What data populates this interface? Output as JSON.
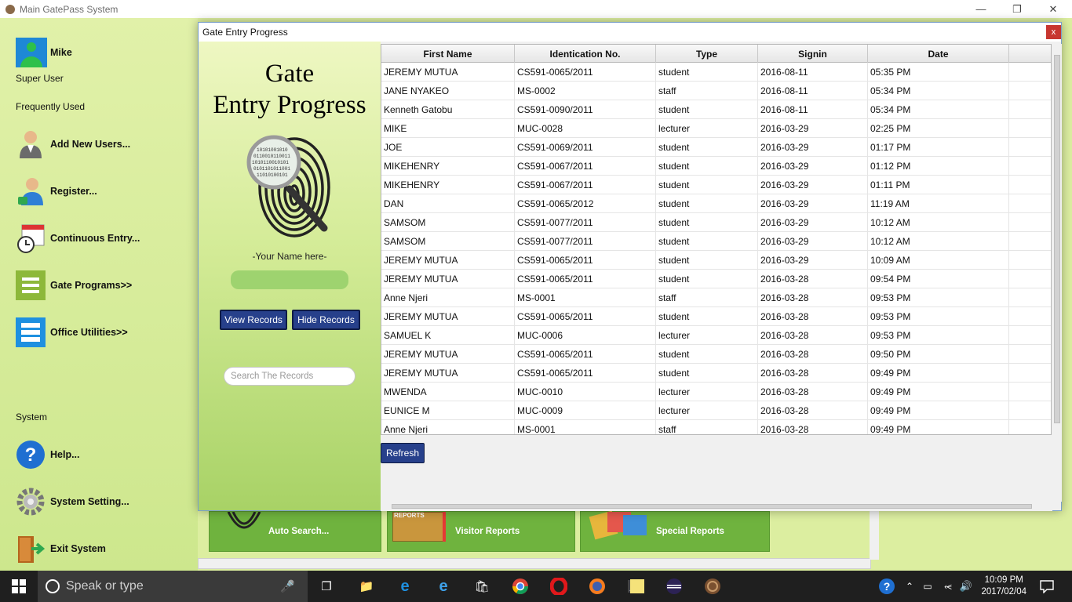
{
  "window": {
    "title": "Main GatePass System"
  },
  "user": {
    "name": "Mike",
    "role": "Super User"
  },
  "sidebar": {
    "frequently_used": "Frequently Used",
    "items": [
      {
        "label": "Add New Users..."
      },
      {
        "label": "Register..."
      },
      {
        "label": "Continuous Entry..."
      },
      {
        "label": "Gate Programs>>"
      },
      {
        "label": "Office Utilities>>"
      }
    ],
    "system_header": "System",
    "system_items": [
      {
        "label": "Help..."
      },
      {
        "label": "System Setting..."
      },
      {
        "label": "Exit System"
      }
    ]
  },
  "bottom_tiles": [
    {
      "label": "Auto Search..."
    },
    {
      "label": "Visitor Reports",
      "badge": "REPORTS"
    },
    {
      "label": "Special Reports"
    }
  ],
  "dialog": {
    "title": "Gate Entry Progress",
    "close_label": "x",
    "heading_line1": "Gate",
    "heading_line2": "Entry Progress",
    "your_name": "-Your Name here-",
    "view_records": "View Records",
    "hide_records": "Hide Records",
    "search_placeholder": "Search The Records",
    "refresh": "Refresh"
  },
  "table": {
    "columns": [
      "First Name",
      "Identication No.",
      "Type",
      "Signin",
      "Date"
    ],
    "rows": [
      [
        "JEREMY MUTUA",
        "CS591-0065/2011",
        "student",
        "2016-08-11",
        "05:35 PM"
      ],
      [
        "JANE NYAKEO",
        "MS-0002",
        "staff",
        "2016-08-11",
        "05:34 PM"
      ],
      [
        "Kenneth Gatobu",
        "CS591-0090/2011",
        "student",
        "2016-08-11",
        "05:34 PM"
      ],
      [
        "MIKE",
        "MUC-0028",
        "lecturer",
        "2016-03-29",
        "02:25 PM"
      ],
      [
        "JOE",
        "CS591-0069/2011",
        "student",
        "2016-03-29",
        "01:17 PM"
      ],
      [
        "MIKEHENRY",
        "CS591-0067/2011",
        "student",
        "2016-03-29",
        "01:12 PM"
      ],
      [
        "MIKEHENRY",
        "CS591-0067/2011",
        "student",
        "2016-03-29",
        "01:11 PM"
      ],
      [
        "DAN",
        "CS591-0065/2012",
        "student",
        "2016-03-29",
        "11:19 AM"
      ],
      [
        "SAMSOM",
        "CS591-0077/2011",
        "student",
        "2016-03-29",
        "10:12 AM"
      ],
      [
        "SAMSOM",
        "CS591-0077/2011",
        "student",
        "2016-03-29",
        "10:12 AM"
      ],
      [
        "JEREMY MUTUA",
        "CS591-0065/2011",
        "student",
        "2016-03-29",
        "10:09 AM"
      ],
      [
        "JEREMY MUTUA",
        "CS591-0065/2011",
        "student",
        "2016-03-28",
        "09:54 PM"
      ],
      [
        "Anne Njeri",
        "MS-0001",
        "staff",
        "2016-03-28",
        "09:53 PM"
      ],
      [
        "JEREMY MUTUA",
        "CS591-0065/2011",
        "student",
        "2016-03-28",
        "09:53 PM"
      ],
      [
        "SAMUEL K",
        "MUC-0006",
        "lecturer",
        "2016-03-28",
        "09:53 PM"
      ],
      [
        "JEREMY MUTUA",
        "CS591-0065/2011",
        "student",
        "2016-03-28",
        "09:50 PM"
      ],
      [
        "JEREMY MUTUA",
        "CS591-0065/2011",
        "student",
        "2016-03-28",
        "09:49 PM"
      ],
      [
        "MWENDA",
        "MUC-0010",
        "lecturer",
        "2016-03-28",
        "09:49 PM"
      ],
      [
        "EUNICE M",
        "MUC-0009",
        "lecturer",
        "2016-03-28",
        "09:49 PM"
      ],
      [
        "Anne Njeri",
        "MS-0001",
        "staff",
        "2016-03-28",
        "09:49 PM"
      ]
    ]
  },
  "taskbar": {
    "search_placeholder": "Speak or type",
    "time": "10:09 PM",
    "date": "2017/02/04"
  },
  "colors": {
    "sidebar_bg": "#dceea0",
    "tile_green": "#6fb33e",
    "button_navy": "#27408b",
    "close_red": "#c7362f"
  }
}
